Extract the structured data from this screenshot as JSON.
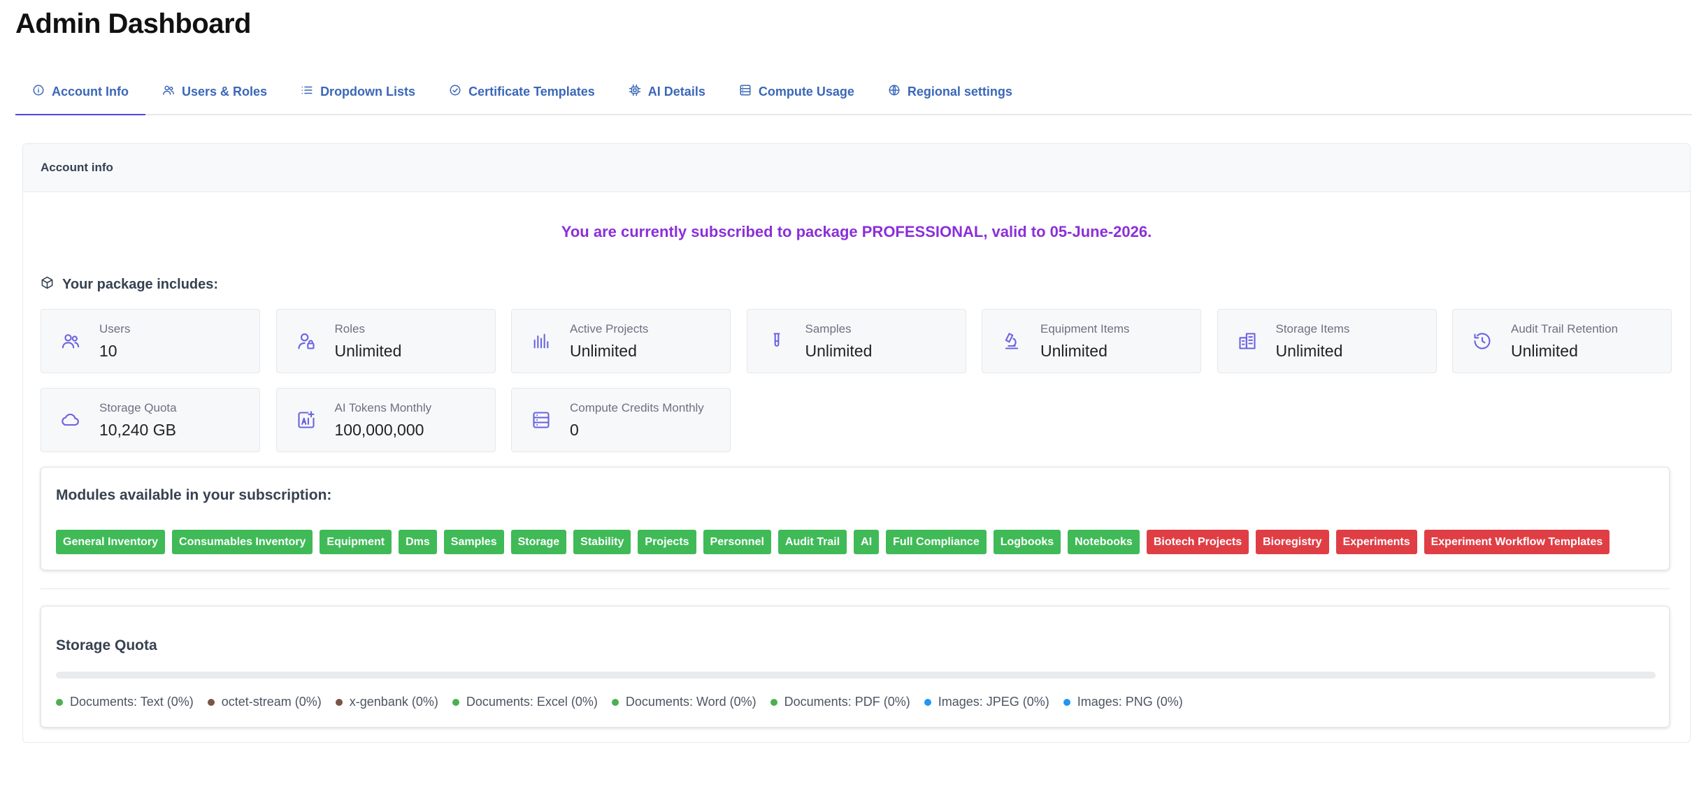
{
  "page": {
    "title": "Admin Dashboard"
  },
  "tabs": [
    {
      "label": "Account Info",
      "icon": "info-icon",
      "active": true
    },
    {
      "label": "Users & Roles",
      "icon": "users-icon"
    },
    {
      "label": "Dropdown Lists",
      "icon": "list-icon"
    },
    {
      "label": "Certificate Templates",
      "icon": "check-circle-icon"
    },
    {
      "label": "AI Details",
      "icon": "cpu-icon"
    },
    {
      "label": "Compute Usage",
      "icon": "server-icon"
    },
    {
      "label": "Regional settings",
      "icon": "globe-icon"
    }
  ],
  "account": {
    "header": "Account info",
    "subscription_text": "You are currently subscribed to package PROFESSIONAL, valid to 05-June-2026.",
    "package_heading": "Your package includes:",
    "stats": [
      {
        "label": "Users",
        "value": "10",
        "icon": "users-icon"
      },
      {
        "label": "Roles",
        "value": "Unlimited",
        "icon": "user-lock-icon"
      },
      {
        "label": "Active Projects",
        "value": "Unlimited",
        "icon": "bar-chart-icon"
      },
      {
        "label": "Samples",
        "value": "Unlimited",
        "icon": "test-tube-icon"
      },
      {
        "label": "Equipment Items",
        "value": "Unlimited",
        "icon": "microscope-icon"
      },
      {
        "label": "Storage Items",
        "value": "Unlimited",
        "icon": "building-icon"
      },
      {
        "label": "Audit Trail Retention",
        "value": "Unlimited",
        "icon": "history-icon"
      },
      {
        "label": "Storage Quota",
        "value": "10,240 GB",
        "icon": "cloud-icon"
      },
      {
        "label": "AI Tokens Monthly",
        "value": "100,000,000",
        "icon": "ai-image-icon"
      },
      {
        "label": "Compute Credits Monthly",
        "value": "0",
        "icon": "server-icon"
      }
    ]
  },
  "modules": {
    "heading": "Modules available in your subscription:",
    "colors": {
      "enabled": "#3fba57",
      "disabled": "#e03e45"
    },
    "items": [
      {
        "label": "General Inventory",
        "enabled": true
      },
      {
        "label": "Consumables Inventory",
        "enabled": true
      },
      {
        "label": "Equipment",
        "enabled": true
      },
      {
        "label": "Dms",
        "enabled": true
      },
      {
        "label": "Samples",
        "enabled": true
      },
      {
        "label": "Storage",
        "enabled": true
      },
      {
        "label": "Stability",
        "enabled": true
      },
      {
        "label": "Projects",
        "enabled": true
      },
      {
        "label": "Personnel",
        "enabled": true
      },
      {
        "label": "Audit Trail",
        "enabled": true
      },
      {
        "label": "AI",
        "enabled": true
      },
      {
        "label": "Full Compliance",
        "enabled": true
      },
      {
        "label": "Logbooks",
        "enabled": true
      },
      {
        "label": "Notebooks",
        "enabled": true
      },
      {
        "label": "Biotech Projects",
        "enabled": false
      },
      {
        "label": "Bioregistry",
        "enabled": false
      },
      {
        "label": "Experiments",
        "enabled": false
      },
      {
        "label": "Experiment Workflow Templates",
        "enabled": false
      }
    ]
  },
  "storage_quota": {
    "heading": "Storage Quota",
    "used_fraction": 0,
    "legend": [
      {
        "label": "Documents: Text (0%)",
        "color": "#4caf50"
      },
      {
        "label": "octet-stream (0%)",
        "color": "#795548"
      },
      {
        "label": "x-genbank (0%)",
        "color": "#795548"
      },
      {
        "label": "Documents: Excel (0%)",
        "color": "#4caf50"
      },
      {
        "label": "Documents: Word (0%)",
        "color": "#4caf50"
      },
      {
        "label": "Documents: PDF (0%)",
        "color": "#4caf50"
      },
      {
        "label": "Images: JPEG (0%)",
        "color": "#2196f3"
      },
      {
        "label": "Images: PNG (0%)",
        "color": "#2196f3"
      }
    ]
  }
}
